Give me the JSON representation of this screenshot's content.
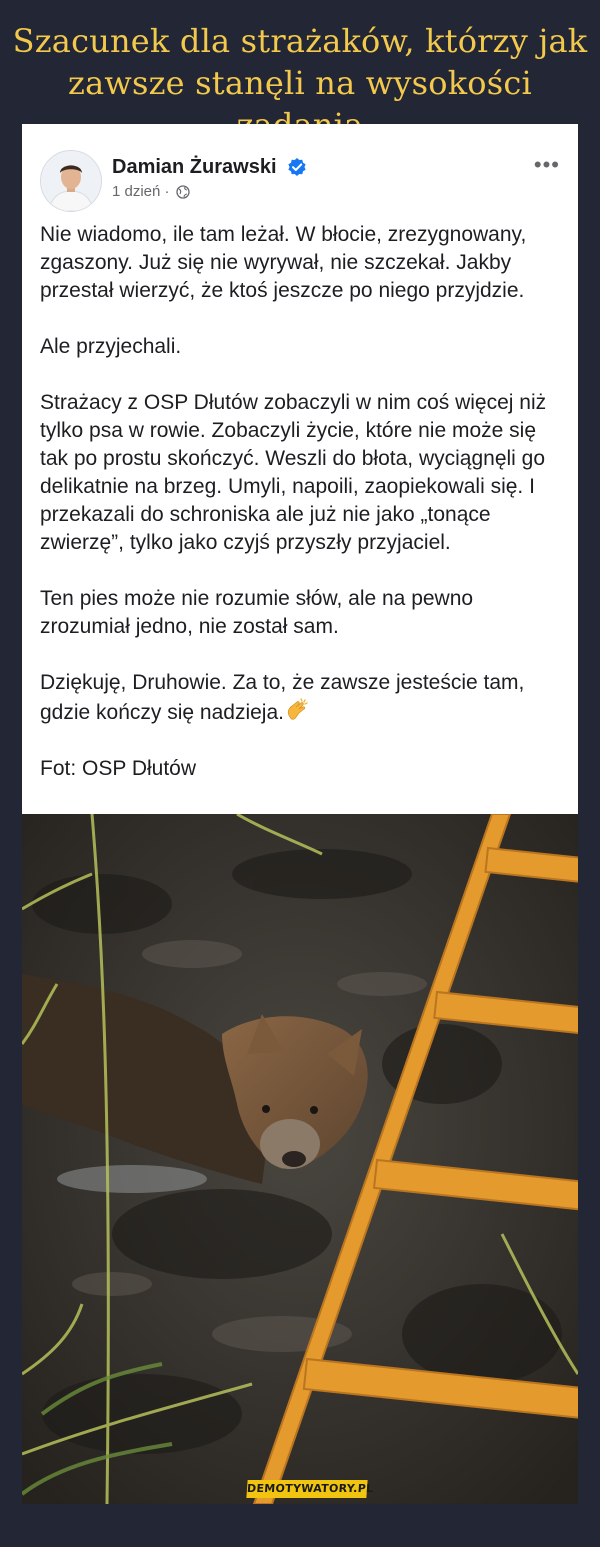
{
  "headline": {
    "line1": "Szacunek dla strażaków, którzy jak",
    "line2": "zawsze stanęli na wysokości zadania"
  },
  "post": {
    "author": "Damian Żurawski",
    "time": "1 dzień",
    "separator": "·",
    "more": "•••",
    "paragraphs": [
      "Nie wiadomo, ile tam leżał. W błocie, zrezygnowany, zgaszony. Już się nie wyrywał, nie szczekał. Jakby przestał wierzyć, że ktoś jeszcze po niego przyjdzie.",
      "Ale przyjechali.",
      "Strażacy z OSP Dłutów zobaczyli w nim coś więcej niż tylko psa w rowie. Zobaczyli życie, które nie może się tak po prostu skończyć. Weszli do błota, wyciągnęli go delikatnie na brzeg. Umyli, napoili, zaopiekowali się. I przekazali do schroniska ale już nie jako „tonące zwierzę”, tylko jako czyjś przyszły przyjaciel.",
      "Ten pies może nie rozumie słów, ale na pewno zrozumiał jedno, nie został sam.",
      "Dziękuję, Druhowie. Za to, że zawsze jesteście tam, gdzie kończy się nadzieja.",
      "Fot: OSP Dłutów"
    ]
  },
  "watermark": "DEMOTYWATORY.PL",
  "colors": {
    "background": "#232634",
    "headline": "#f2c94c",
    "verified": "#1877f2",
    "ladder": "#e59a2e"
  }
}
